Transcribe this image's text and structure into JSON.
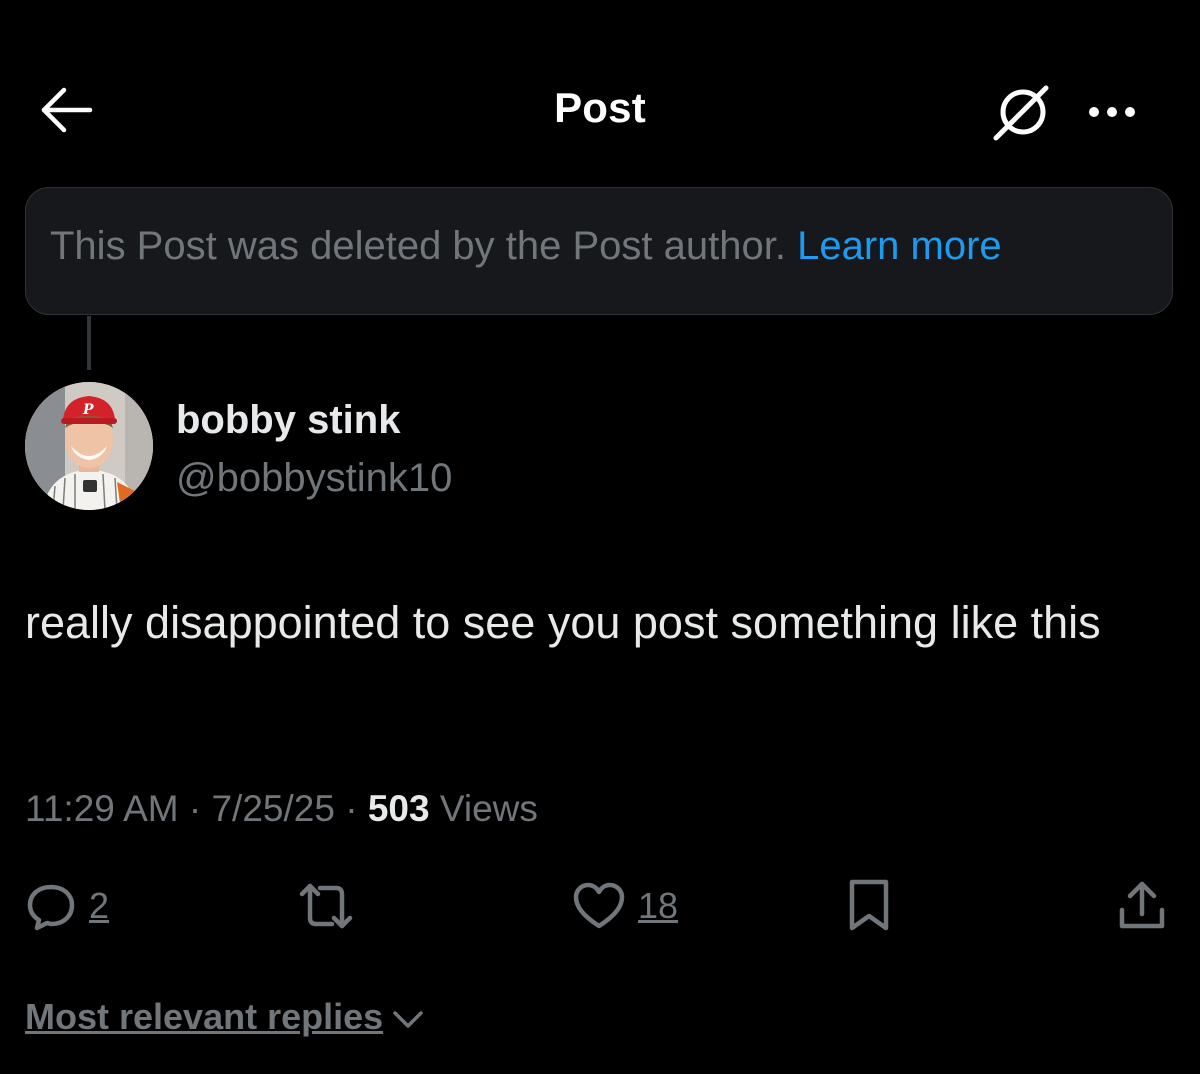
{
  "header": {
    "title": "Post",
    "back_icon": "arrow-left-icon",
    "grok_icon": "grok-icon",
    "more_icon": "more-dots-icon"
  },
  "deleted_notice": {
    "text": "This Post was deleted by the Post author.",
    "link": "Learn more"
  },
  "author": {
    "display_name": "bobby stink",
    "handle": "@bobbystink10",
    "avatar_icon": "avatar"
  },
  "post": {
    "text": "really disappointed to see you post something like this"
  },
  "meta": {
    "time": "11:29 AM",
    "separator": "·",
    "date": "7/25/25",
    "views_count": "503",
    "views_label": "Views"
  },
  "actions": {
    "reply_count": "2",
    "repost_count": "",
    "like_count": "18"
  },
  "replies": {
    "sort_label": "Most relevant replies"
  },
  "colors": {
    "background": "#000000",
    "text_primary": "#e7e9ea",
    "text_secondary": "#71767b",
    "accent": "#1d9bf0",
    "notice_bg": "#16181c"
  }
}
